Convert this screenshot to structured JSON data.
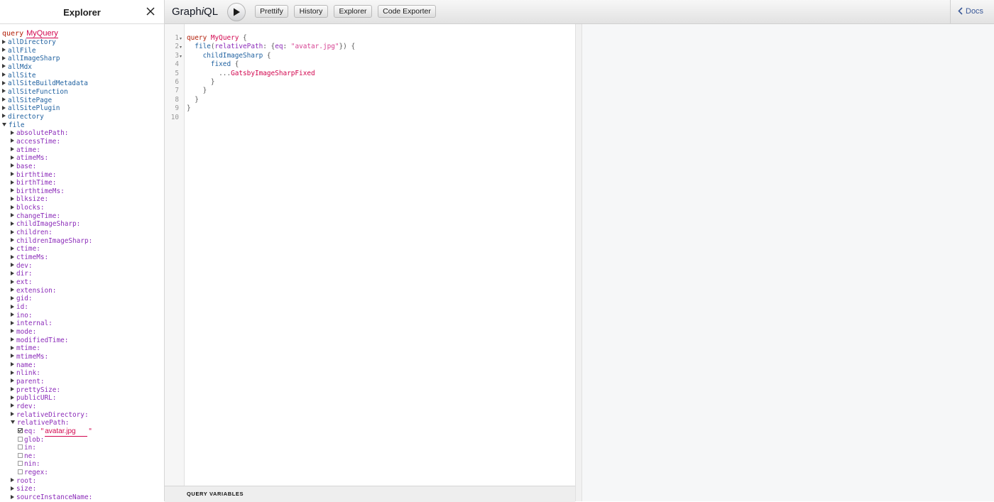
{
  "explorer": {
    "title": "Explorer",
    "operation_keyword": "query",
    "operation_name": "MyQuery",
    "root_fields": [
      "allDirectory",
      "allFile",
      "allImageSharp",
      "allMdx",
      "allSite",
      "allSiteBuildMetadata",
      "allSiteFunction",
      "allSitePage",
      "allSitePlugin",
      "directory"
    ],
    "expanded_field": "file",
    "file_args": [
      "absolutePath:",
      "accessTime:",
      "atime:",
      "atimeMs:",
      "base:",
      "birthtime:",
      "birthTime:",
      "birthtimeMs:",
      "blksize:",
      "blocks:",
      "changeTime:",
      "childImageSharp:",
      "children:",
      "childrenImageSharp:",
      "ctime:",
      "ctimeMs:",
      "dev:",
      "dir:",
      "ext:",
      "extension:",
      "gid:",
      "id:",
      "ino:",
      "internal:",
      "mode:",
      "modifiedTime:",
      "mtime:",
      "mtimeMs:",
      "name:",
      "nlink:",
      "parent:",
      "prettySize:",
      "publicURL:",
      "rdev:",
      "relativeDirectory:"
    ],
    "expanded_arg": "relativePath:",
    "relative_path_ops": [
      {
        "label": "eq:",
        "checked": true,
        "value": "avatar.jpg"
      },
      {
        "label": "glob:",
        "checked": false
      },
      {
        "label": "in:",
        "checked": false
      },
      {
        "label": "ne:",
        "checked": false
      },
      {
        "label": "nin:",
        "checked": false
      },
      {
        "label": "regex:",
        "checked": false
      }
    ],
    "after_args": [
      "root:",
      "size:",
      "sourceInstanceName:"
    ]
  },
  "toolbar": {
    "title_prefix": "Graph",
    "title_i": "i",
    "title_suffix": "QL",
    "prettify": "Prettify",
    "history": "History",
    "explorer": "Explorer",
    "code_exporter": "Code Exporter",
    "docs": "Docs"
  },
  "editor": {
    "line_numbers": [
      "1",
      "2",
      "3",
      "4",
      "5",
      "6",
      "7",
      "8",
      "9",
      "10"
    ],
    "lines": [
      [
        {
          "t": "query",
          "c": "kw"
        },
        {
          "t": " "
        },
        {
          "t": "MyQuery",
          "c": "def"
        },
        {
          "t": " {",
          "c": "punct"
        }
      ],
      [
        {
          "t": "  "
        },
        {
          "t": "file",
          "c": "prop"
        },
        {
          "t": "(",
          "c": "punct"
        },
        {
          "t": "relativePath",
          "c": "attr"
        },
        {
          "t": ": {",
          "c": "punct"
        },
        {
          "t": "eq",
          "c": "attr"
        },
        {
          "t": ": ",
          "c": "punct"
        },
        {
          "t": "\"avatar.jpg\"",
          "c": "str"
        },
        {
          "t": "}) {",
          "c": "punct"
        }
      ],
      [
        {
          "t": "    "
        },
        {
          "t": "childImageSharp",
          "c": "prop"
        },
        {
          "t": " {",
          "c": "punct"
        }
      ],
      [
        {
          "t": "      "
        },
        {
          "t": "fixed",
          "c": "prop"
        },
        {
          "t": " {",
          "c": "punct"
        }
      ],
      [
        {
          "t": "        "
        },
        {
          "t": "...",
          "c": "punct"
        },
        {
          "t": "GatsbyImageSharpFixed",
          "c": "def"
        }
      ],
      [
        {
          "t": "      "
        },
        {
          "t": "}",
          "c": "punct"
        }
      ],
      [
        {
          "t": "    "
        },
        {
          "t": "}",
          "c": "punct"
        }
      ],
      [
        {
          "t": "  "
        },
        {
          "t": "}",
          "c": "punct"
        }
      ],
      [
        {
          "t": "}",
          "c": "punct"
        }
      ],
      []
    ],
    "fold_lines": [
      1,
      2,
      3
    ],
    "query_variables_label": "QUERY VARIABLES"
  },
  "colors": {
    "keyword": "#b11a04",
    "definition": "#d2054e",
    "property": "#1f61a0",
    "attribute": "#8b2bb9",
    "string": "#d64292"
  }
}
